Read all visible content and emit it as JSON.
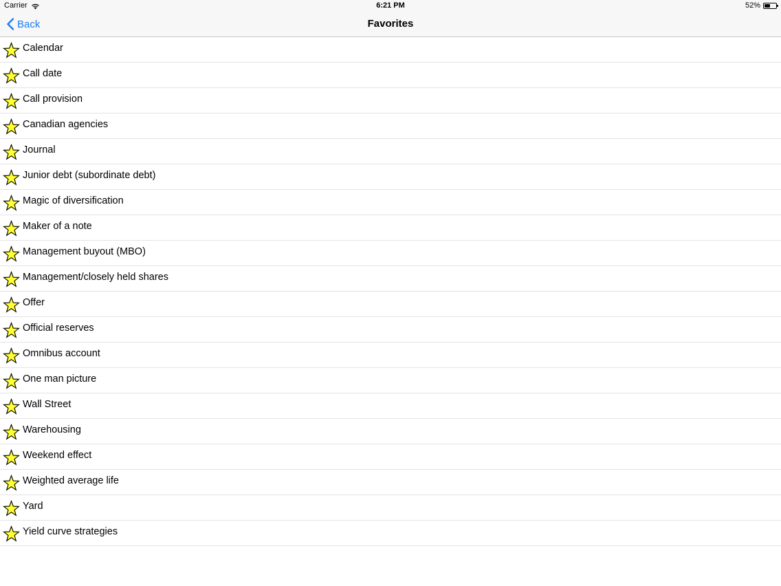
{
  "status_bar": {
    "carrier": "Carrier",
    "time": "6:21 PM",
    "battery_percent": "52%",
    "battery_level": 0.52
  },
  "nav": {
    "back_label": "Back",
    "title": "Favorites",
    "accent_color": "#1a7cf5"
  },
  "favorites": {
    "star_fill_color": "#ffff33",
    "items": [
      "Calendar",
      "Call date",
      "Call provision",
      "Canadian agencies",
      "Journal",
      "Junior debt (subordinate debt)",
      "Magic of diversification",
      "Maker of a note",
      "Management buyout (MBO)",
      "Management/closely held shares",
      "Offer",
      "Official reserves",
      "Omnibus account",
      "One man picture",
      "Wall Street",
      "Warehousing",
      "Weekend effect",
      "Weighted average life",
      "Yard",
      "Yield curve strategies"
    ]
  }
}
